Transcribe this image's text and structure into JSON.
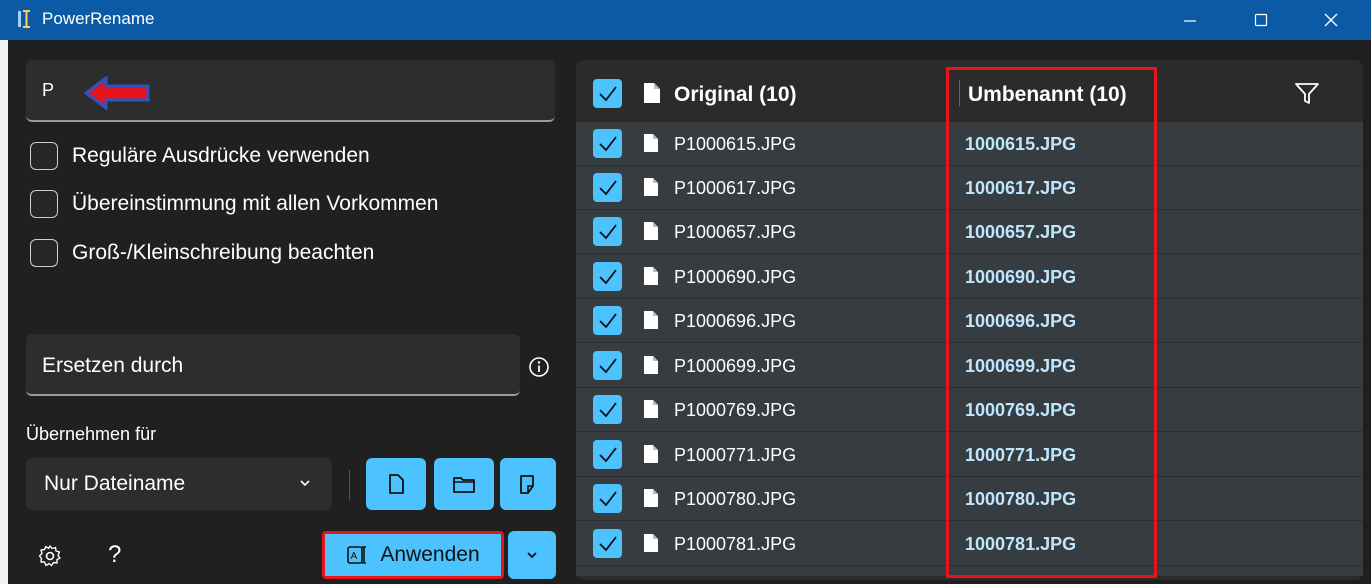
{
  "window": {
    "title": "PowerRename",
    "minimize_icon": "minimize-icon",
    "maximize_icon": "maximize-icon",
    "close_icon": "close-icon"
  },
  "search": {
    "value": "P"
  },
  "options": [
    {
      "label": "Reguläre Ausdrücke verwenden",
      "checked": false
    },
    {
      "label": "Übereinstimmung mit allen Vorkommen",
      "checked": false
    },
    {
      "label": "Groß-/Kleinschreibung beachten",
      "checked": false
    }
  ],
  "replace": {
    "placeholder": "Ersetzen durch"
  },
  "apply_for": {
    "label": "Übernehmen für",
    "selected": "Nur Dateiname"
  },
  "apply_button": {
    "label": "Anwenden"
  },
  "table": {
    "header_original": "Original (10)",
    "header_renamed": "Umbenannt (10)",
    "rows": [
      {
        "original": "P1000615.JPG",
        "renamed": "1000615.JPG"
      },
      {
        "original": "P1000617.JPG",
        "renamed": "1000617.JPG"
      },
      {
        "original": "P1000657.JPG",
        "renamed": "1000657.JPG"
      },
      {
        "original": "P1000690.JPG",
        "renamed": "1000690.JPG"
      },
      {
        "original": "P1000696.JPG",
        "renamed": "1000696.JPG"
      },
      {
        "original": "P1000699.JPG",
        "renamed": "1000699.JPG"
      },
      {
        "original": "P1000769.JPG",
        "renamed": "1000769.JPG"
      },
      {
        "original": "P1000771.JPG",
        "renamed": "1000771.JPG"
      },
      {
        "original": "P1000780.JPG",
        "renamed": "1000780.JPG"
      },
      {
        "original": "P1000781.JPG",
        "renamed": "1000781.JPG"
      }
    ]
  },
  "colors": {
    "titlebar": "#0c5aa6",
    "accent": "#4cc2ff",
    "highlight": "#e8141b"
  }
}
